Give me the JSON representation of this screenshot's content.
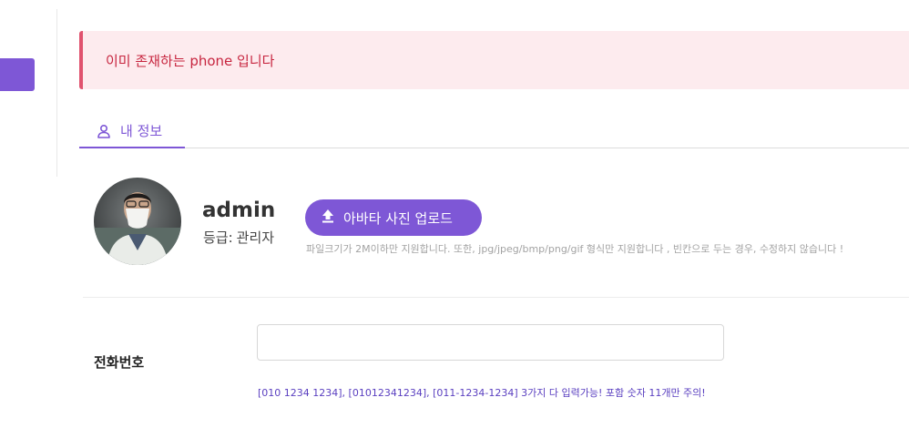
{
  "alert": {
    "message": "이미 존재하는 phone 입니다"
  },
  "tabs": [
    {
      "label": "내 정보",
      "icon": "user-icon",
      "active": true
    }
  ],
  "profile": {
    "username": "admin",
    "grade_label": "등급:",
    "grade_value": "관리자",
    "upload_button": "아바타 사진 업로드",
    "upload_icon": "upload-icon",
    "upload_hint": "파일크기가 2M이하만 지원합니다. 또한, jpg/jpeg/bmp/png/gif 형식만 지원합니다 , 빈칸으로 두는 경우, 수정하지 않습니다 !"
  },
  "phone": {
    "label": "전화번호",
    "value": "",
    "placeholder": "",
    "hint": "[010 1234 1234], [01012341234], [011-1234-1234] 3가지 다 입력가능! 포함 숫자 11개만 주의!"
  },
  "colors": {
    "accent": "#7e57d6",
    "alert_bg": "#fdebee",
    "alert_border": "#e0526e",
    "alert_text": "#c7253f"
  }
}
